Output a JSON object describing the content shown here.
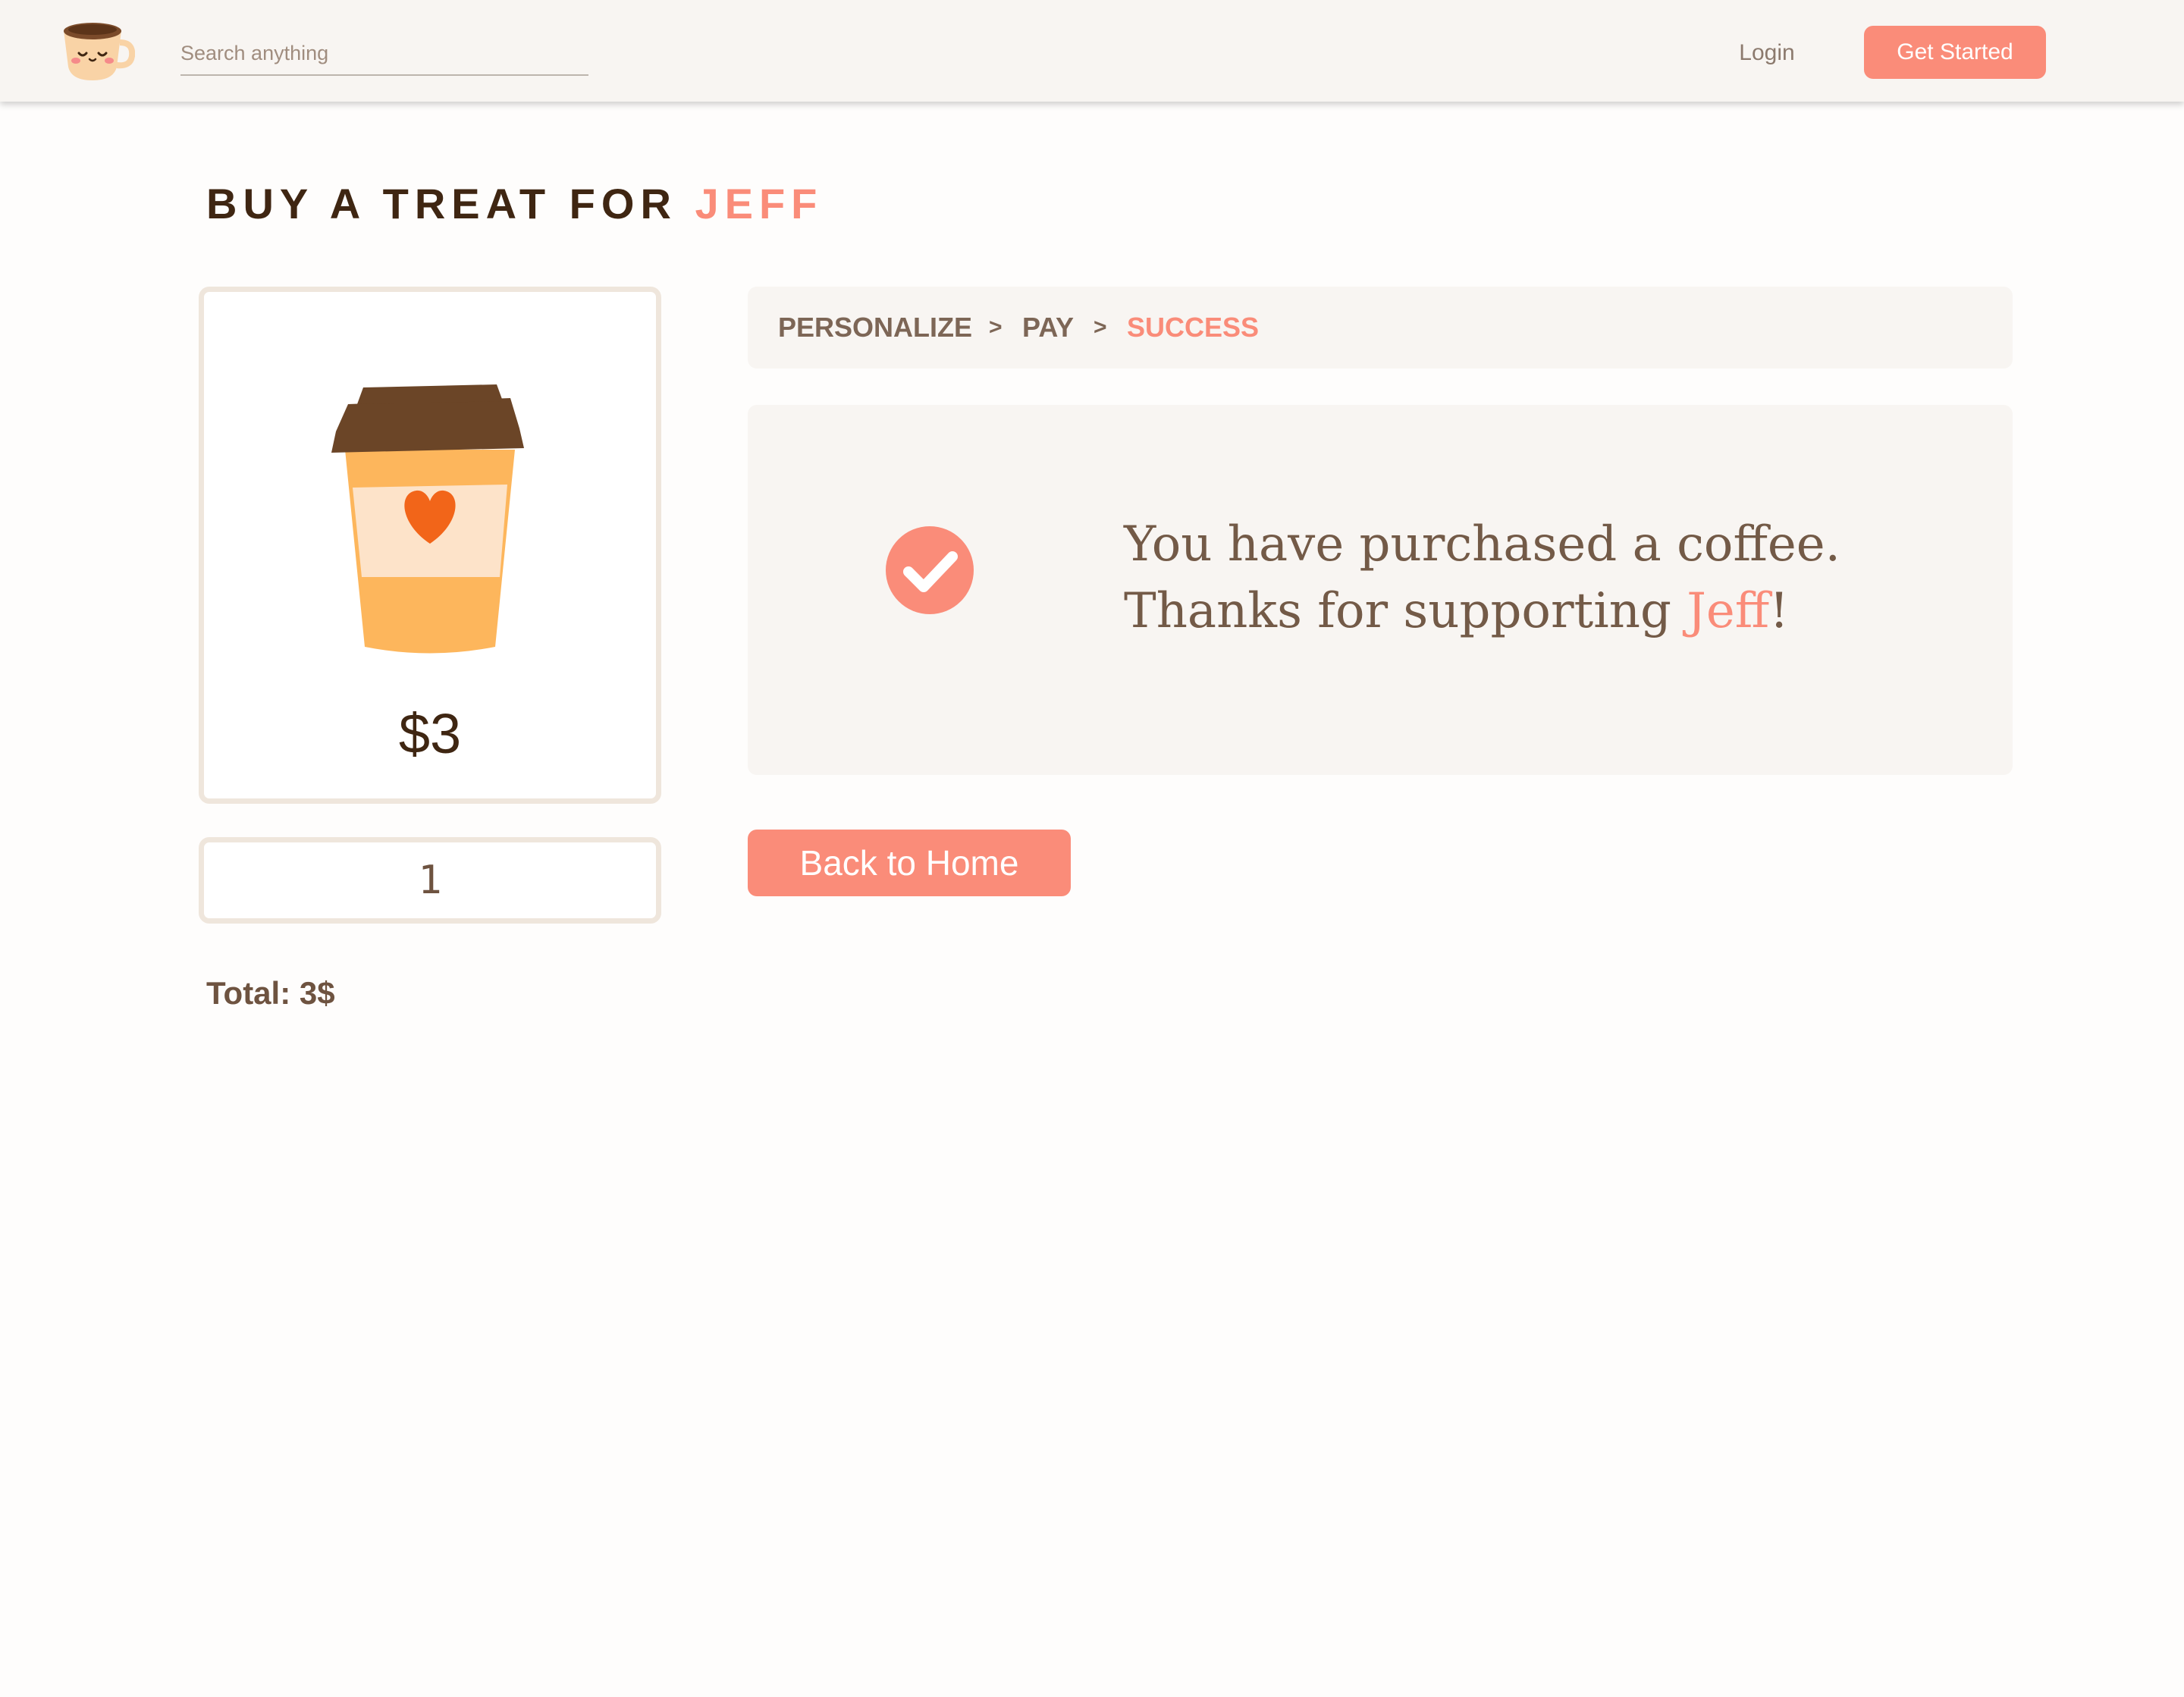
{
  "navbar": {
    "logo_icon": "smiling-coffee-cup-logo",
    "search_placeholder": "Search anything",
    "login_label": "Login",
    "cta_label": "Get Started"
  },
  "page": {
    "title_prefix": "BUY A TREAT FOR",
    "title_name": "JEFF"
  },
  "product": {
    "icon": "coffee-cup-with-heart",
    "price": "$3",
    "quantity": "1",
    "total": "Total: 3$"
  },
  "steps": [
    {
      "label": "PERSONALIZE"
    },
    {
      "label": "PAY"
    },
    {
      "label": "SUCCESS"
    }
  ],
  "step_separator": ">",
  "success": {
    "icon": "check-circle-icon",
    "line1": "You have purchased a coffee.",
    "line2_prefix": "Thanks for supporting ",
    "line2_name": "Jeff",
    "line2_suffix": "!"
  },
  "home_button_label": "Back to Home",
  "colors": {
    "accent": "#fa8c79",
    "text_dark": "#3f2612",
    "text_brown": "#735a47",
    "panel_bg": "#f8f5f2"
  }
}
